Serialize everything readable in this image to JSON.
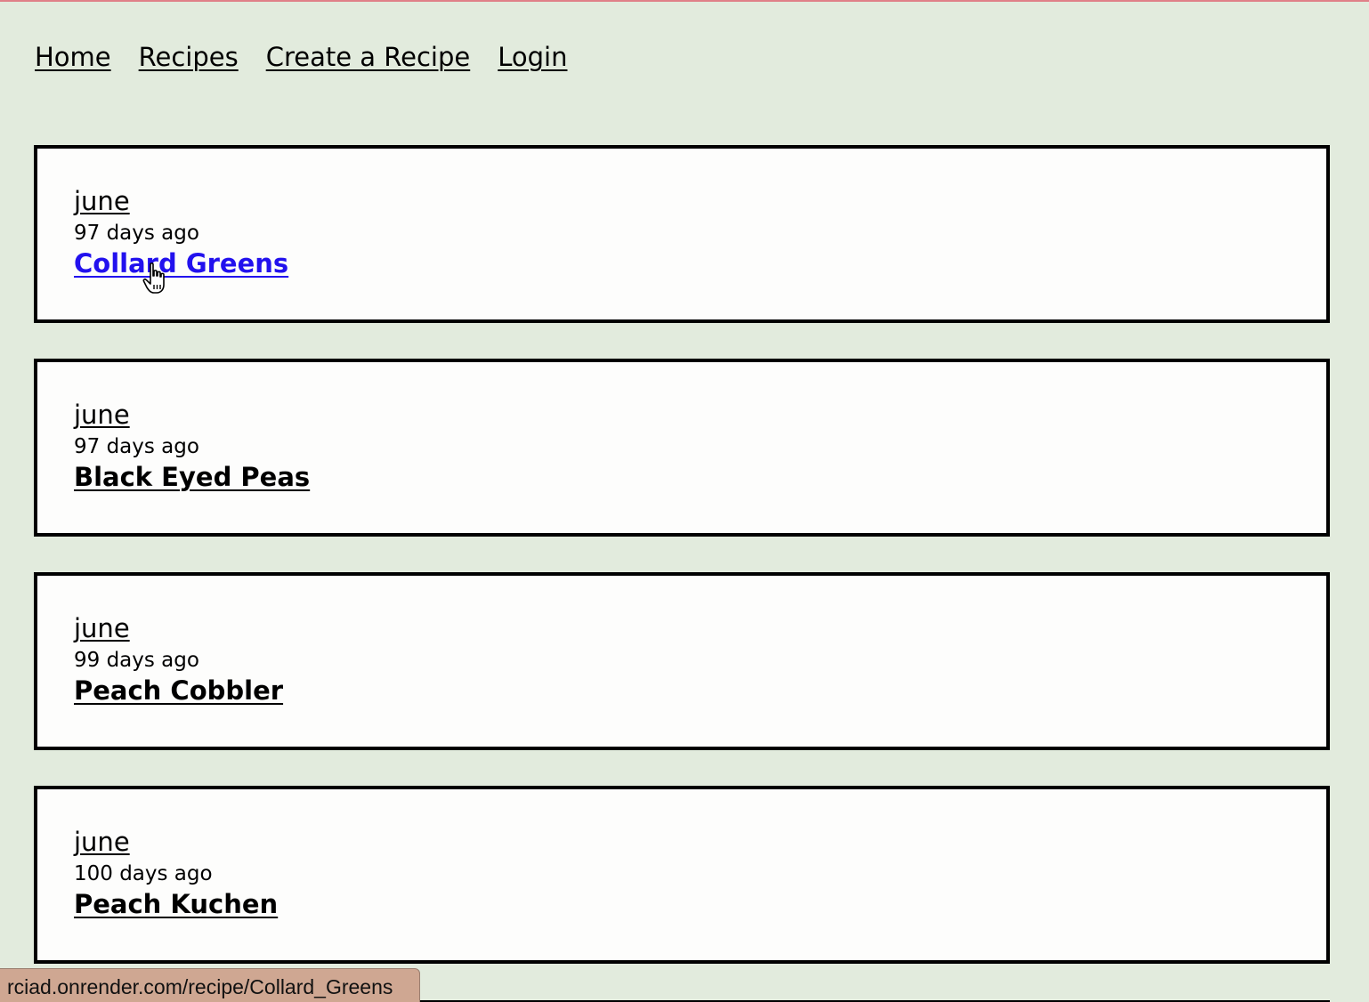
{
  "nav": {
    "items": [
      {
        "label": "Home"
      },
      {
        "label": "Recipes"
      },
      {
        "label": "Create a Recipe"
      },
      {
        "label": "Login"
      }
    ]
  },
  "recipes": [
    {
      "author": "june",
      "age": "97 days ago",
      "title": "Collard Greens"
    },
    {
      "author": "june",
      "age": "97 days ago",
      "title": "Black Eyed Peas"
    },
    {
      "author": "june",
      "age": "99 days ago",
      "title": "Peach Cobbler"
    },
    {
      "author": "june",
      "age": "100 days ago",
      "title": "Peach Kuchen"
    }
  ],
  "status_bar": {
    "url": "rciad.onrender.com/recipe/Collard_Greens"
  },
  "colors": {
    "background": "#e2ebdd",
    "hover_link": "#2211ee",
    "status_bar": "#cfa792"
  },
  "cursor": {
    "icon": "hand-pointer-icon"
  }
}
